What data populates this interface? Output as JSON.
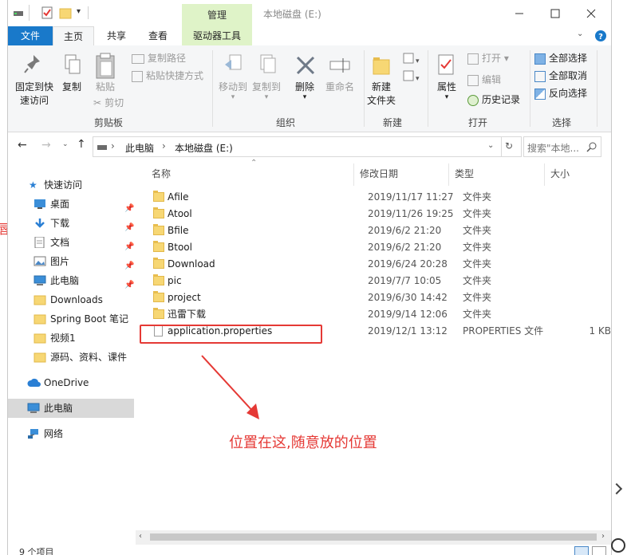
{
  "window": {
    "title": "本地磁盘 (E:)",
    "context_tab": "管理",
    "accent": "#1979ca"
  },
  "ribbon_tabs": {
    "file": "文件",
    "home": "主页",
    "share": "共享",
    "view": "查看",
    "drive_tools": "驱动器工具"
  },
  "ribbon": {
    "clipboard": {
      "pin": "固定到快速访问",
      "pin_l1": "固定到快",
      "pin_l2": "速访问",
      "copy": "复制",
      "paste": "粘贴",
      "copy_path": "复制路径",
      "paste_shortcut": "粘贴快捷方式",
      "cut": "剪切",
      "label": "剪贴板"
    },
    "organize": {
      "move_to": "移动到",
      "copy_to": "复制到",
      "delete": "删除",
      "rename": "重命名",
      "label": "组织"
    },
    "new": {
      "new_folder_l1": "新建",
      "new_folder_l2": "文件夹",
      "label": "新建"
    },
    "open": {
      "properties": "属性",
      "open": "打开",
      "edit": "编辑",
      "history": "历史记录",
      "label": "打开"
    },
    "select": {
      "select_all": "全部选择",
      "select_none": "全部取消",
      "invert": "反向选择",
      "label": "选择"
    }
  },
  "address": {
    "crumb1": "此电脑",
    "crumb2": "本地磁盘 (E:)",
    "search_placeholder": "搜索\"本地...",
    "sep": "›"
  },
  "nav": {
    "quick_access": "快速访问",
    "items": [
      {
        "label": "桌面",
        "icon": "desktop-icon"
      },
      {
        "label": "下载",
        "icon": "download-icon"
      },
      {
        "label": "文档",
        "icon": "document-icon"
      },
      {
        "label": "图片",
        "icon": "picture-icon"
      },
      {
        "label": "此电脑",
        "icon": "pc-icon"
      },
      {
        "label": "Downloads",
        "icon": "folder-icon"
      },
      {
        "label": "Spring Boot 笔记",
        "icon": "folder-icon"
      },
      {
        "label": "视频1",
        "icon": "folder-icon"
      },
      {
        "label": "源码、资料、课件",
        "icon": "folder-icon"
      }
    ],
    "onedrive": "OneDrive",
    "this_pc": "此电脑",
    "network": "网络"
  },
  "columns": {
    "name": "名称",
    "date": "修改日期",
    "type": "类型",
    "size": "大小"
  },
  "files": [
    {
      "name": "Afile",
      "date": "2019/11/17 11:27",
      "type": "文件夹",
      "size": "",
      "kind": "folder"
    },
    {
      "name": "Atool",
      "date": "2019/11/26 19:25",
      "type": "文件夹",
      "size": "",
      "kind": "folder"
    },
    {
      "name": "Bfile",
      "date": "2019/6/2 21:20",
      "type": "文件夹",
      "size": "",
      "kind": "folder"
    },
    {
      "name": "Btool",
      "date": "2019/6/2 21:20",
      "type": "文件夹",
      "size": "",
      "kind": "folder"
    },
    {
      "name": "Download",
      "date": "2019/6/24 20:28",
      "type": "文件夹",
      "size": "",
      "kind": "folder"
    },
    {
      "name": "pic",
      "date": "2019/7/7 10:05",
      "type": "文件夹",
      "size": "",
      "kind": "folder"
    },
    {
      "name": "project",
      "date": "2019/6/30 14:42",
      "type": "文件夹",
      "size": "",
      "kind": "folder"
    },
    {
      "name": "迅雷下载",
      "date": "2019/9/14 12:06",
      "type": "文件夹",
      "size": "",
      "kind": "folder"
    },
    {
      "name": "application.properties",
      "date": "2019/12/1 13:12",
      "type": "PROPERTIES 文件",
      "size": "1 KB",
      "kind": "file"
    }
  ],
  "status": {
    "count": "9 个项目"
  },
  "annotation": {
    "text": "位置在这,随意放的位置",
    "color": "#e53935"
  },
  "edge_glyph": "唇"
}
